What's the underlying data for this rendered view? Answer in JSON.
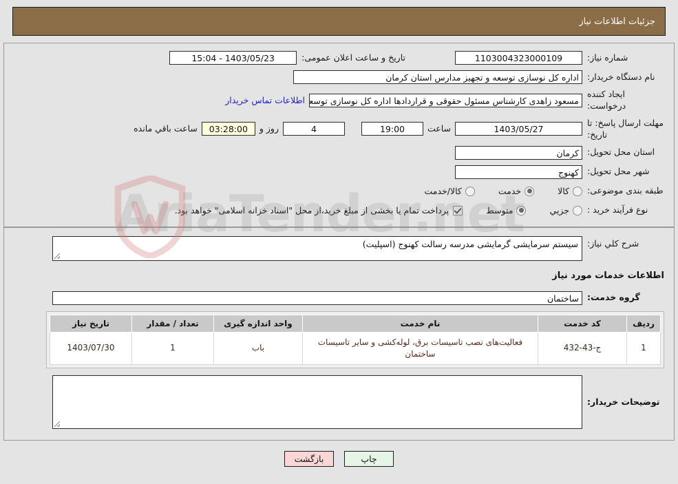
{
  "header": {
    "title": "جزئیات اطلاعات نیاز",
    "bar_color": "#8b6d47"
  },
  "form": {
    "need_number": {
      "label": "شماره نیاز:",
      "value": "1103004323000109"
    },
    "announce": {
      "label": "تاریخ و ساعت اعلان عمومی:",
      "value": "1403/05/23 - 15:04"
    },
    "buyer_org": {
      "label": "نام دستگاه خریدار:",
      "value": "اداره کل نوسازی  توسعه و تجهیز مدارس استان کرمان"
    },
    "request_creator": {
      "label": "ایجاد کننده درخواست:",
      "value": "مسعود زاهدی کارشناس مسئول حقوقی و قراردادها اداره کل نوسازی  توسعه و"
    },
    "contact_link": "اطلاعات تماس خریدار",
    "deadline": {
      "label": "مهلت ارسال پاسخ: تا تاریخ:",
      "date": "1403/05/27",
      "time_label": "ساعت",
      "time": "19:00",
      "days": "4",
      "days_label": "روز و",
      "countdown": "03:28:00",
      "remaining_label": "ساعت باقي مانده"
    },
    "province": {
      "label": "استان محل تحویل:",
      "value": "کرمان"
    },
    "city": {
      "label": "شهر محل تحویل:",
      "value": "کهنوج"
    },
    "category": {
      "label": "طبقه بندی موضوعی:",
      "options": [
        {
          "label": "کالا",
          "selected": false
        },
        {
          "label": "خدمت",
          "selected": true
        },
        {
          "label": "کالا/خدمت",
          "selected": false
        }
      ]
    },
    "purchase_type": {
      "label": "نوع فرآیند خرید :",
      "options": [
        {
          "label": "جزیي",
          "selected": false
        },
        {
          "label": "متوسط",
          "selected": true
        }
      ],
      "checkbox": {
        "checked": true,
        "text": "پرداخت تمام یا بخشی از مبلغ خرید،از محل \"اسناد خزانه اسلامی\" خواهد بود."
      }
    },
    "general_description": {
      "label": "شرح کلي نیاز:",
      "value": "سیستم سرمایشی گرمایشی مدرسه رسالت کهنوج (اسپلیت)"
    },
    "services_section_title": "اطلاعات خدمات مورد نیاز",
    "service_group": {
      "label": "گروه خدمت:",
      "value": "ساختمان"
    },
    "buyer_notes": {
      "label": "توضیحات خریدار:",
      "value": ""
    }
  },
  "table": {
    "headers": [
      "ردیف",
      "کد خدمت",
      "نام خدمت",
      "واحد اندازه گیری",
      "تعداد / مقدار",
      "تاریخ نیاز"
    ],
    "rows": [
      {
        "row": "1",
        "code": "ج-43-432",
        "name": "فعالیت‌های نصب تاسیسات برق، لوله‌کشی و سایر تاسیسات ساختمان",
        "unit": "باب",
        "qty": "1",
        "date": "1403/07/30"
      }
    ]
  },
  "buttons": {
    "print": "چاپ",
    "back": "بازگشت"
  },
  "watermark": {
    "text": "AriaTender.net"
  }
}
